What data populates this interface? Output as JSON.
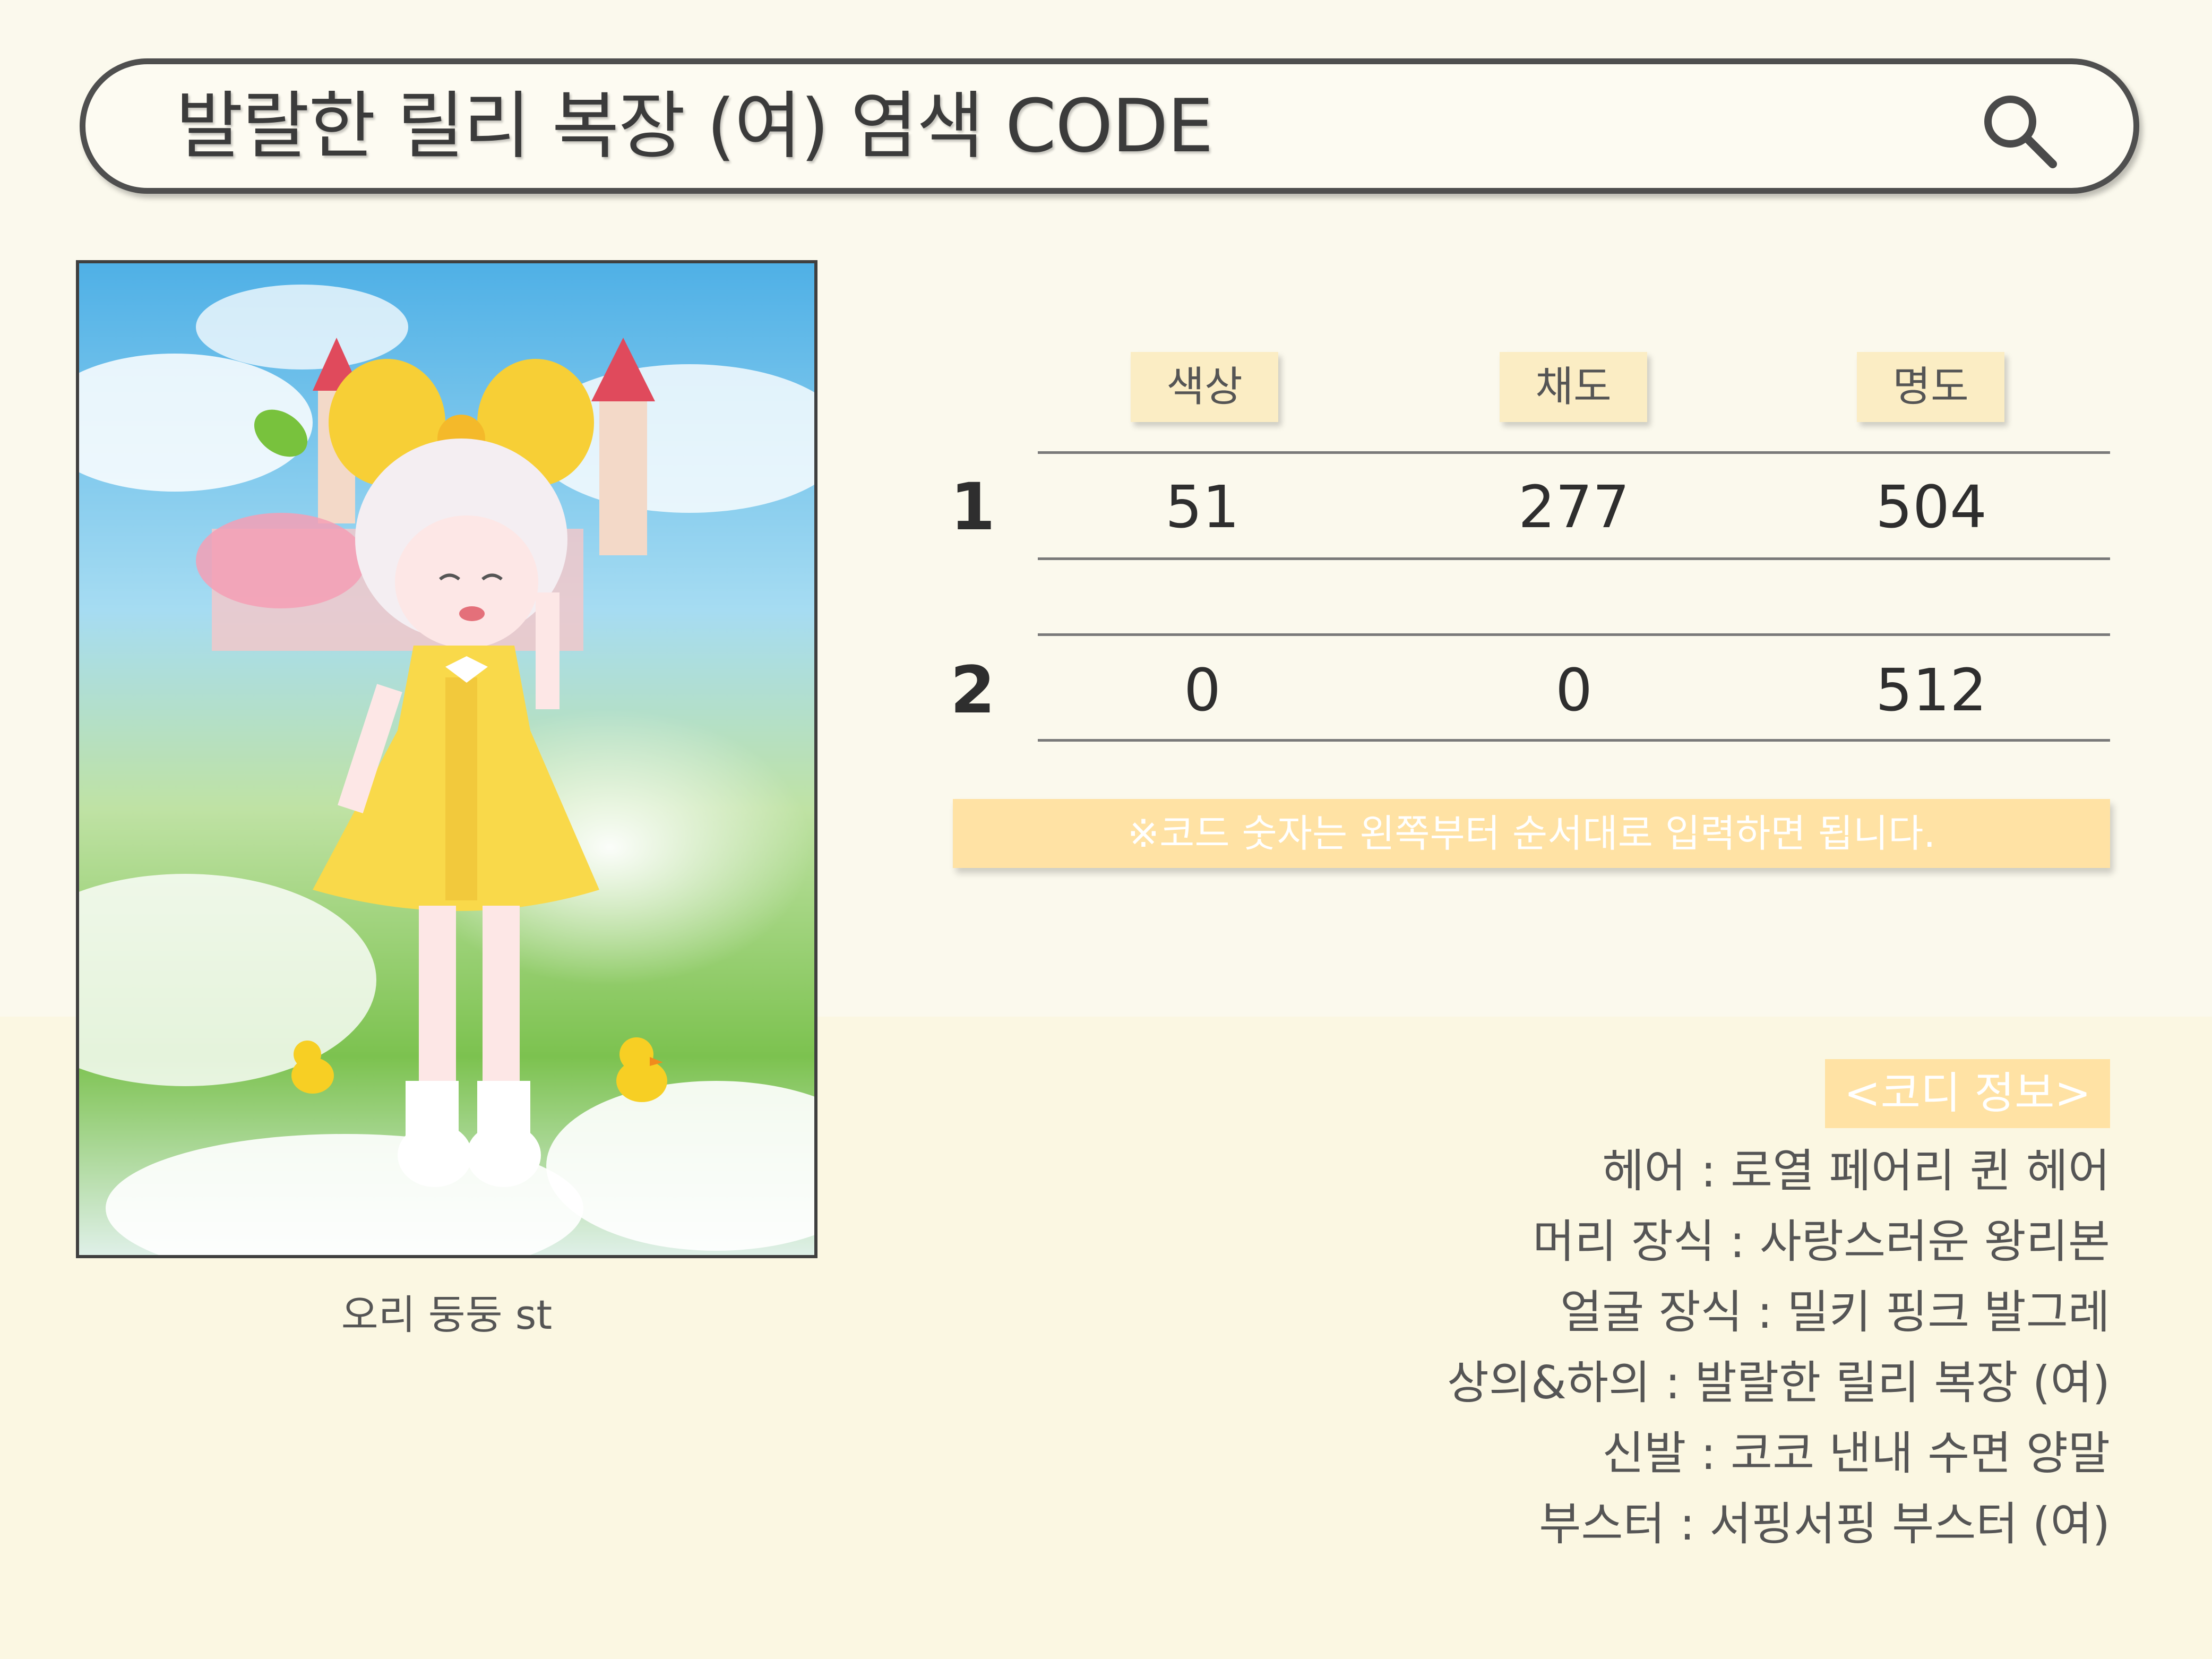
{
  "search": {
    "title": "발랄한 릴리 복장 (여) 염색 CODE",
    "icon": "search-icon"
  },
  "preview": {
    "caption": "오리 둥둥 st"
  },
  "table": {
    "headers": [
      "색상",
      "채도",
      "명도"
    ],
    "rows": [
      {
        "label": "1",
        "values": [
          "51",
          "277",
          "504"
        ]
      },
      {
        "label": "2",
        "values": [
          "0",
          "0",
          "512"
        ]
      }
    ]
  },
  "notice": "※코드 숫자는 왼쪽부터 순서대로 입력하면 됩니다.",
  "info": {
    "tag": "<코디 정보>",
    "lines": [
      "헤어 : 로열 페어리 퀸 헤어",
      "머리 장식 : 사랑스러운 왕리본",
      "얼굴 장식 : 밀키 핑크 발그레",
      "상의&하의 : 발랄한 릴리 복장 (여)",
      "신발 : 코코 낸내 수면 양말",
      "부스터 : 서핑서핑 부스터 (여)"
    ]
  },
  "colors": {
    "background": "#fbf9ed",
    "accent": "#ffe2a4",
    "header_chip": "#fbedc4",
    "dress": "#f9d94a"
  }
}
